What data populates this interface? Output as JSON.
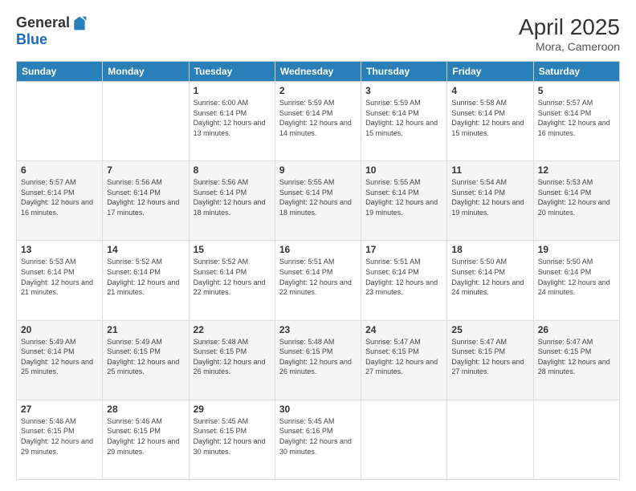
{
  "header": {
    "logo_general": "General",
    "logo_blue": "Blue",
    "month_title": "April 2025",
    "subtitle": "Mora, Cameroon"
  },
  "days_of_week": [
    "Sunday",
    "Monday",
    "Tuesday",
    "Wednesday",
    "Thursday",
    "Friday",
    "Saturday"
  ],
  "weeks": [
    [
      {
        "day": "",
        "info": ""
      },
      {
        "day": "",
        "info": ""
      },
      {
        "day": "1",
        "info": "Sunrise: 6:00 AM\nSunset: 6:14 PM\nDaylight: 12 hours and 13 minutes."
      },
      {
        "day": "2",
        "info": "Sunrise: 5:59 AM\nSunset: 6:14 PM\nDaylight: 12 hours and 14 minutes."
      },
      {
        "day": "3",
        "info": "Sunrise: 5:59 AM\nSunset: 6:14 PM\nDaylight: 12 hours and 15 minutes."
      },
      {
        "day": "4",
        "info": "Sunrise: 5:58 AM\nSunset: 6:14 PM\nDaylight: 12 hours and 15 minutes."
      },
      {
        "day": "5",
        "info": "Sunrise: 5:57 AM\nSunset: 6:14 PM\nDaylight: 12 hours and 16 minutes."
      }
    ],
    [
      {
        "day": "6",
        "info": "Sunrise: 5:57 AM\nSunset: 6:14 PM\nDaylight: 12 hours and 16 minutes."
      },
      {
        "day": "7",
        "info": "Sunrise: 5:56 AM\nSunset: 6:14 PM\nDaylight: 12 hours and 17 minutes."
      },
      {
        "day": "8",
        "info": "Sunrise: 5:56 AM\nSunset: 6:14 PM\nDaylight: 12 hours and 18 minutes."
      },
      {
        "day": "9",
        "info": "Sunrise: 5:55 AM\nSunset: 6:14 PM\nDaylight: 12 hours and 18 minutes."
      },
      {
        "day": "10",
        "info": "Sunrise: 5:55 AM\nSunset: 6:14 PM\nDaylight: 12 hours and 19 minutes."
      },
      {
        "day": "11",
        "info": "Sunrise: 5:54 AM\nSunset: 6:14 PM\nDaylight: 12 hours and 19 minutes."
      },
      {
        "day": "12",
        "info": "Sunrise: 5:53 AM\nSunset: 6:14 PM\nDaylight: 12 hours and 20 minutes."
      }
    ],
    [
      {
        "day": "13",
        "info": "Sunrise: 5:53 AM\nSunset: 6:14 PM\nDaylight: 12 hours and 21 minutes."
      },
      {
        "day": "14",
        "info": "Sunrise: 5:52 AM\nSunset: 6:14 PM\nDaylight: 12 hours and 21 minutes."
      },
      {
        "day": "15",
        "info": "Sunrise: 5:52 AM\nSunset: 6:14 PM\nDaylight: 12 hours and 22 minutes."
      },
      {
        "day": "16",
        "info": "Sunrise: 5:51 AM\nSunset: 6:14 PM\nDaylight: 12 hours and 22 minutes."
      },
      {
        "day": "17",
        "info": "Sunrise: 5:51 AM\nSunset: 6:14 PM\nDaylight: 12 hours and 23 minutes."
      },
      {
        "day": "18",
        "info": "Sunrise: 5:50 AM\nSunset: 6:14 PM\nDaylight: 12 hours and 24 minutes."
      },
      {
        "day": "19",
        "info": "Sunrise: 5:50 AM\nSunset: 6:14 PM\nDaylight: 12 hours and 24 minutes."
      }
    ],
    [
      {
        "day": "20",
        "info": "Sunrise: 5:49 AM\nSunset: 6:14 PM\nDaylight: 12 hours and 25 minutes."
      },
      {
        "day": "21",
        "info": "Sunrise: 5:49 AM\nSunset: 6:15 PM\nDaylight: 12 hours and 25 minutes."
      },
      {
        "day": "22",
        "info": "Sunrise: 5:48 AM\nSunset: 6:15 PM\nDaylight: 12 hours and 26 minutes."
      },
      {
        "day": "23",
        "info": "Sunrise: 5:48 AM\nSunset: 6:15 PM\nDaylight: 12 hours and 26 minutes."
      },
      {
        "day": "24",
        "info": "Sunrise: 5:47 AM\nSunset: 6:15 PM\nDaylight: 12 hours and 27 minutes."
      },
      {
        "day": "25",
        "info": "Sunrise: 5:47 AM\nSunset: 6:15 PM\nDaylight: 12 hours and 27 minutes."
      },
      {
        "day": "26",
        "info": "Sunrise: 5:47 AM\nSunset: 6:15 PM\nDaylight: 12 hours and 28 minutes."
      }
    ],
    [
      {
        "day": "27",
        "info": "Sunrise: 5:46 AM\nSunset: 6:15 PM\nDaylight: 12 hours and 29 minutes."
      },
      {
        "day": "28",
        "info": "Sunrise: 5:46 AM\nSunset: 6:15 PM\nDaylight: 12 hours and 29 minutes."
      },
      {
        "day": "29",
        "info": "Sunrise: 5:45 AM\nSunset: 6:15 PM\nDaylight: 12 hours and 30 minutes."
      },
      {
        "day": "30",
        "info": "Sunrise: 5:45 AM\nSunset: 6:16 PM\nDaylight: 12 hours and 30 minutes."
      },
      {
        "day": "",
        "info": ""
      },
      {
        "day": "",
        "info": ""
      },
      {
        "day": "",
        "info": ""
      }
    ]
  ]
}
